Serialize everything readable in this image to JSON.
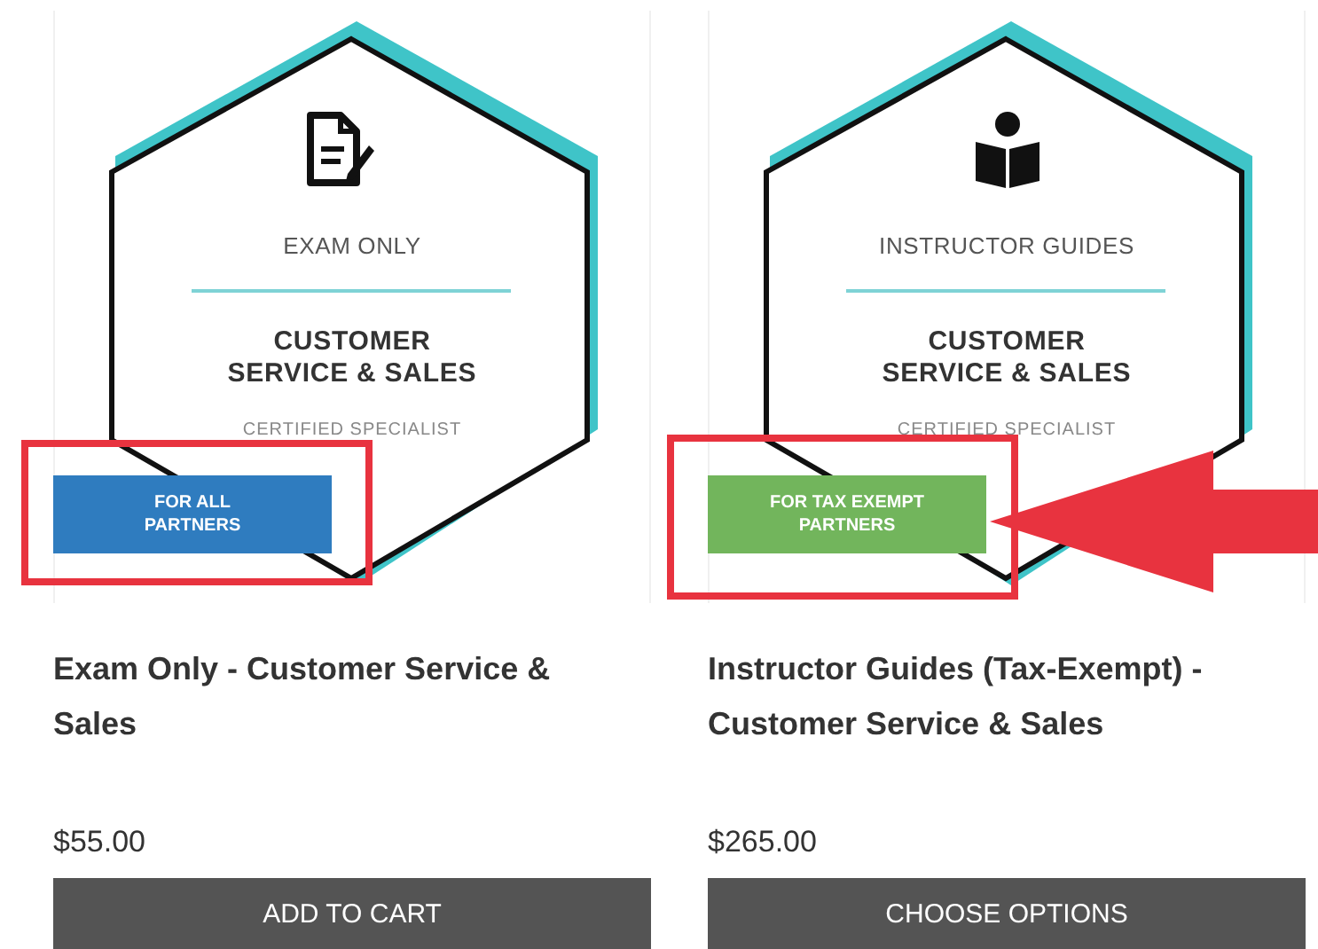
{
  "products": [
    {
      "badge_category": "EXAM ONLY",
      "badge_title_lines": [
        "CUSTOMER",
        "SERVICE & SALES"
      ],
      "badge_subtitle": "CERTIFIED SPECIALIST",
      "ribbon": {
        "lines": [
          "FOR ALL",
          "PARTNERS"
        ],
        "color": "#2f7cbf"
      },
      "highlighted": true,
      "arrow": false,
      "title": "Exam Only - Customer Service & Sales",
      "price": "$55.00",
      "button": "ADD TO CART"
    },
    {
      "badge_category": "INSTRUCTOR GUIDES",
      "badge_title_lines": [
        "CUSTOMER",
        "SERVICE & SALES"
      ],
      "badge_subtitle": "CERTIFIED SPECIALIST",
      "ribbon": {
        "lines": [
          "FOR TAX EXEMPT",
          "PARTNERS"
        ],
        "color": "#72b55c"
      },
      "highlighted": true,
      "arrow": true,
      "title": "Instructor Guides (Tax-Exempt) - Customer Service & Sales",
      "price": "$265.00",
      "button": "CHOOSE OPTIONS"
    }
  ]
}
